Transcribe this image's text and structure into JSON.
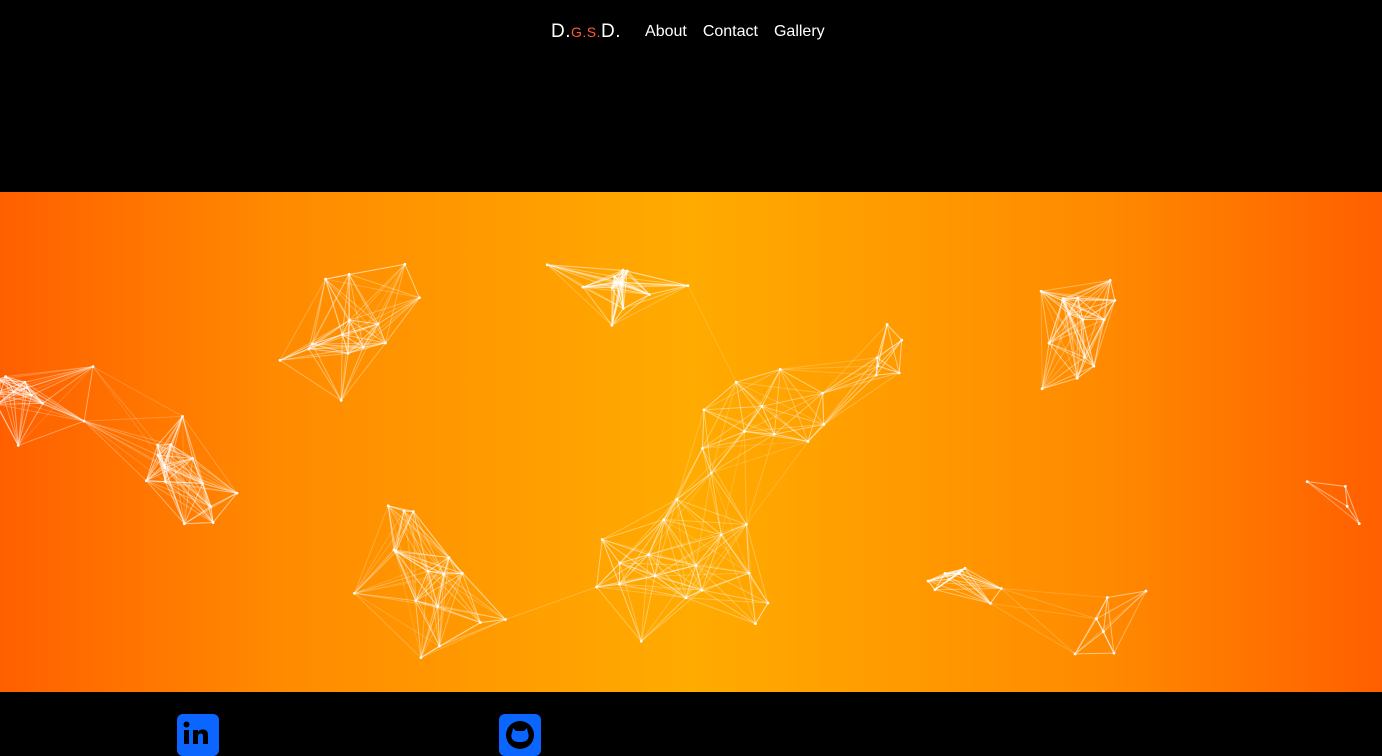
{
  "nav": {
    "brand": {
      "part1": "D.",
      "part2": "G.S.",
      "part3": "D."
    },
    "links": [
      {
        "label": "About"
      },
      {
        "label": "Contact"
      },
      {
        "label": "Gallery"
      }
    ]
  },
  "theme": {
    "background": "#000000",
    "hero_gradient": [
      "#ff5f00",
      "#ffab00",
      "#ff5f00"
    ],
    "brand_accent": "#ff5a3c",
    "social_icon_bg": "#0a66ff"
  },
  "social": {
    "icons": [
      "linkedin-icon",
      "github-icon"
    ]
  }
}
